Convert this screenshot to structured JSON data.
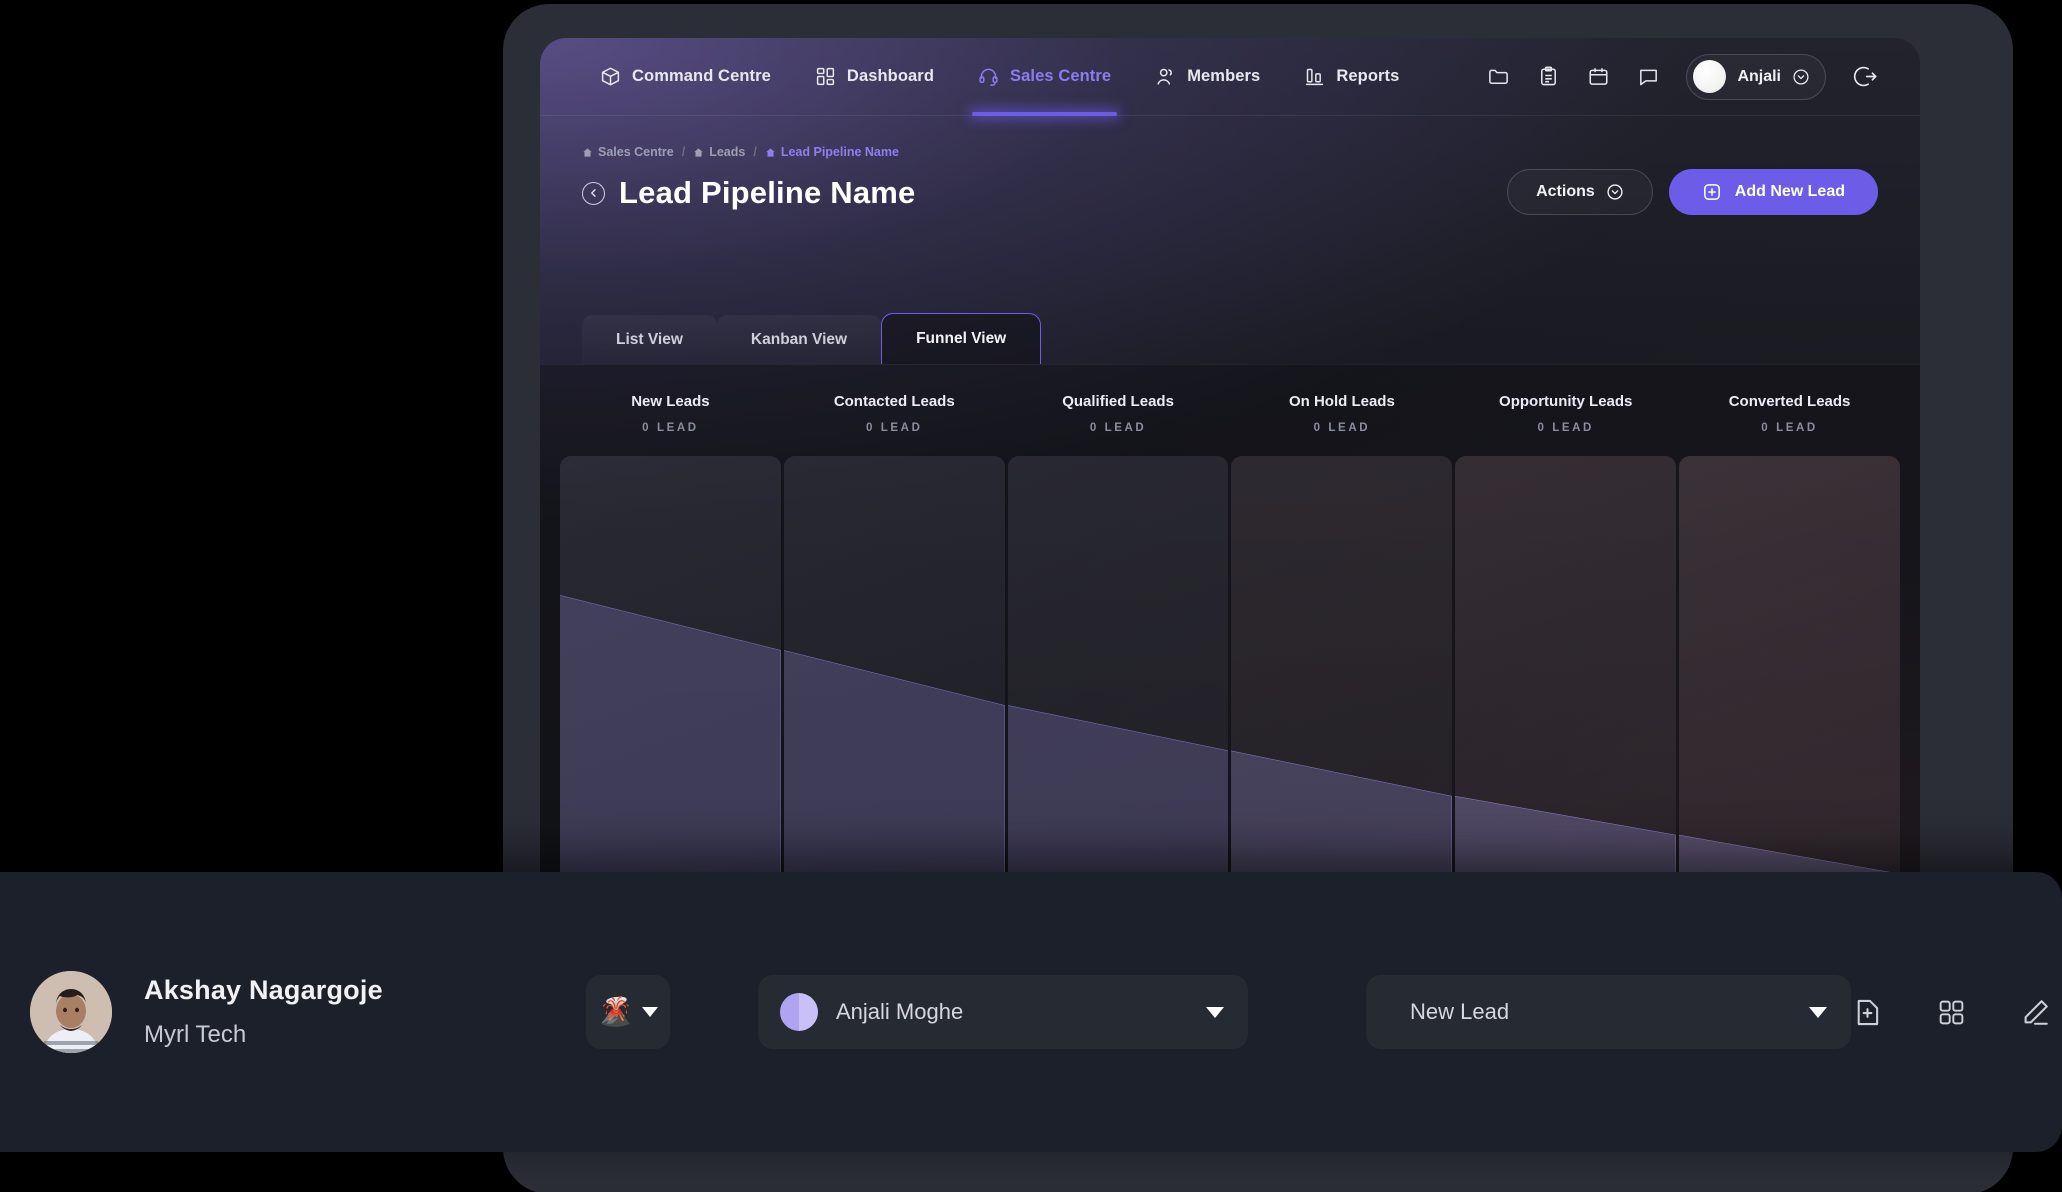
{
  "topnav": {
    "items": [
      {
        "label": "Command Centre",
        "icon": "cube-icon",
        "active": false
      },
      {
        "label": "Dashboard",
        "icon": "dashboard-grid-icon",
        "active": false
      },
      {
        "label": "Sales Centre",
        "icon": "headset-icon",
        "active": true
      },
      {
        "label": "Members",
        "icon": "people-icon",
        "active": false
      },
      {
        "label": "Reports",
        "icon": "bar-chart-icon",
        "active": false
      }
    ],
    "right_icons": [
      "folder-icon",
      "clipboard-icon",
      "calendar-icon",
      "chat-bubble-icon"
    ],
    "user": {
      "name": "Anjali",
      "chevron": "chevron-down-circle-icon"
    },
    "logout_icon": "logout-icon"
  },
  "breadcrumb": [
    {
      "label": "Sales Centre",
      "current": false
    },
    {
      "label": "Leads",
      "current": false
    },
    {
      "label": "Lead Pipeline Name",
      "current": true
    }
  ],
  "header": {
    "title": "Lead Pipeline Name",
    "back_icon": "back-circle-icon",
    "actions_label": "Actions",
    "add_lead_label": "Add New Lead"
  },
  "tabs": [
    {
      "label": "List View",
      "active": false
    },
    {
      "label": "Kanban View",
      "active": false
    },
    {
      "label": "Funnel View",
      "active": true
    }
  ],
  "chart_data": {
    "type": "funnel",
    "title": "Lead Pipeline Name",
    "unit_label": "LEAD",
    "categories": [
      "New Leads",
      "Contacted Leads",
      "Qualified Leads",
      "On Hold Leads",
      "Opportunity Leads",
      "Converted Leads"
    ],
    "values": [
      0,
      0,
      0,
      0,
      0,
      0
    ],
    "count_labels": [
      "0 LEAD",
      "0 LEAD",
      "0 LEAD",
      "0 LEAD",
      "0 LEAD",
      "0 LEAD"
    ],
    "stage_top_fraction": [
      0.215,
      0.3,
      0.385,
      0.455,
      0.525,
      0.585
    ],
    "stage_end_fraction": [
      0.3,
      0.385,
      0.455,
      0.525,
      0.585,
      0.645
    ],
    "accent": "#6c5ce7",
    "fill": "rgba(134,124,196,0.30)",
    "stroke": "#8b7fd6"
  },
  "funnel_columns": [
    {
      "title": "New Leads",
      "count": "0 LEAD"
    },
    {
      "title": "Contacted Leads",
      "count": "0 LEAD"
    },
    {
      "title": "Qualified Leads",
      "count": "0 LEAD"
    },
    {
      "title": "On Hold Leads",
      "count": "0 LEAD"
    },
    {
      "title": "Opportunity Leads",
      "count": "0 LEAD"
    },
    {
      "title": "Converted Leads",
      "count": "0 LEAD"
    }
  ],
  "overlay": {
    "person_name": "Akshay Nagargoje",
    "company": "Myrl Tech",
    "emoji": "🌋",
    "owner_name": "Anjali Moghe",
    "stage_value": "New Lead",
    "tool_icons": [
      "file-plus-icon",
      "grid-apps-icon",
      "edit-pencil-icon",
      "trash-icon"
    ]
  },
  "colors": {
    "accent": "#6c5ce7",
    "accent_text": "#8b7cf0",
    "overlay_bg": "#1b202a",
    "window_bg": "#16171d",
    "frame": "#2b2d37"
  }
}
